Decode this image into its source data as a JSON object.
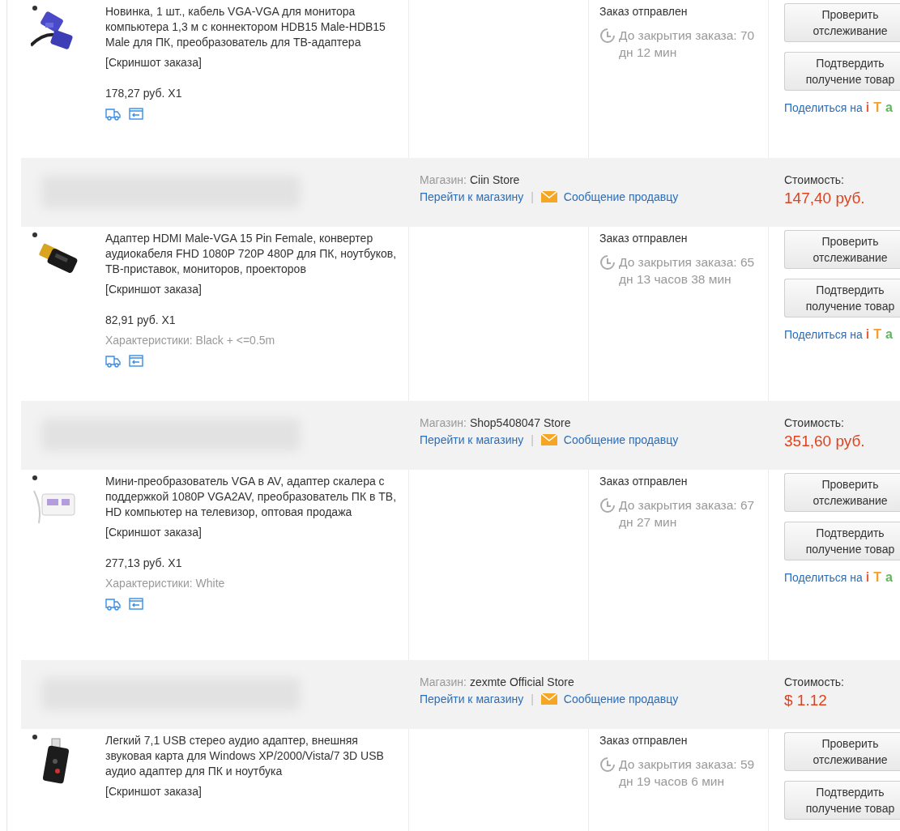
{
  "rows": [
    {
      "kind": "item",
      "title": "Новинка, 1 шт., кабель VGA-VGA для монитора компьютера 1,3 м с коннектором HDB15 Male-HDB15 Male для ПК, преобразователь для ТВ-адаптера",
      "screenshot": "[Скриншот заказа]",
      "price": "178,27 руб. X1",
      "status": "Заказ отправлен",
      "countdown": "До закрытия заказа: 70 дн 12 мин",
      "buttons": [
        "Проверить отслеживание",
        "Подтвердить получение товар"
      ],
      "share": {
        "label": "Поделиться на",
        "icons": [
          {
            "text": "i",
            "color": "#e8603c"
          },
          {
            "text": "T",
            "color": "#f0a030"
          },
          {
            "text": "a",
            "color": "#5cb85c"
          }
        ]
      }
    },
    {
      "kind": "store",
      "label": "Магазин:",
      "name": "Ciin Store",
      "store_link": "Перейти к магазину",
      "separator": "|",
      "message_link": "Сообщение продавцу",
      "cost_label": "Стоимость:",
      "cost": "147,40 руб."
    },
    {
      "kind": "item",
      "title": "Адаптер HDMI Male-VGA 15 Pin Female, конвертер аудиокабеля FHD 1080P 720P 480P для ПК, ноутбуков, ТВ-приставок, мониторов, проекторов",
      "screenshot": "[Скриншот заказа]",
      "price": "82,91 руб. X1",
      "specs": "Характеристики: Black + <=0.5m",
      "status": "Заказ отправлен",
      "countdown": "До закрытия заказа: 65 дн 13 часов 38 мин",
      "buttons": [
        "Проверить отслеживание",
        "Подтвердить получение товар"
      ],
      "share": {
        "label": "Поделиться на",
        "icons": [
          {
            "text": "i",
            "color": "#e8603c"
          },
          {
            "text": "T",
            "color": "#f0a030"
          },
          {
            "text": "a",
            "color": "#5cb85c"
          }
        ]
      }
    },
    {
      "kind": "store",
      "label": "Магазин:",
      "name": "Shop5408047 Store",
      "store_link": "Перейти к магазину",
      "separator": "|",
      "message_link": "Сообщение продавцу",
      "cost_label": "Стоимость:",
      "cost": "351,60 руб."
    },
    {
      "kind": "item",
      "title": "Мини-преобразователь VGA в AV, адаптер скалера с поддержкой 1080P VGA2AV, преобразователь ПК в ТВ, HD компьютер на телевизор, оптовая продажа",
      "screenshot": "[Скриншот заказа]",
      "price": "277,13 руб. X1",
      "specs": "Характеристики: White",
      "status": "Заказ отправлен",
      "countdown": "До закрытия заказа: 67 дн 27 мин",
      "buttons": [
        "Проверить отслеживание",
        "Подтвердить получение товар"
      ],
      "share": {
        "label": "Поделиться на",
        "icons": [
          {
            "text": "i",
            "color": "#e8603c"
          },
          {
            "text": "T",
            "color": "#f0a030"
          },
          {
            "text": "a",
            "color": "#5cb85c"
          }
        ]
      }
    },
    {
      "kind": "store",
      "label": "Магазин:",
      "name": "zexmte Official Store",
      "store_link": "Перейти к магазину",
      "separator": "|",
      "message_link": "Сообщение продавцу",
      "cost_label": "Стоимость:",
      "cost": "$ 1.12"
    },
    {
      "kind": "item",
      "title": "Легкий 7,1 USB стерео аудио адаптер, внешняя звуковая карта для Windows XP/2000/Vista/7 3D USB аудио адаптер для ПК и ноутбука",
      "screenshot": "[Скриншот заказа]",
      "status": "Заказ отправлен",
      "countdown": "До закрытия заказа: 59 дн 19 часов 6 мин",
      "buttons": [
        "Проверить отслеживание",
        "Подтвердить получение товар"
      ]
    }
  ]
}
